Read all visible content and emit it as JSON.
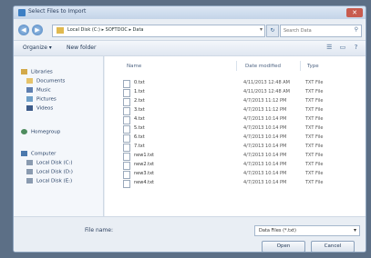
{
  "window": {
    "title": "Select Files to Import"
  },
  "address": {
    "path": "Local Disk (C:) ▸ SOFTDOC ▸ Data",
    "search_placeholder": "Search Data"
  },
  "toolbar": {
    "organize": "Organize ▾",
    "new_folder": "New folder"
  },
  "sidebar": {
    "items": [
      {
        "label": "Libraries",
        "icon": "library-icon"
      },
      {
        "label": "Documents",
        "icon": "documents-icon"
      },
      {
        "label": "Music",
        "icon": "music-icon"
      },
      {
        "label": "Pictures",
        "icon": "pictures-icon"
      },
      {
        "label": "Videos",
        "icon": "videos-icon"
      },
      {
        "label": "Homegroup",
        "icon": "homegroup-icon"
      },
      {
        "label": "Computer",
        "icon": "computer-icon"
      },
      {
        "label": "Local Disk (C:)",
        "icon": "drive-icon"
      },
      {
        "label": "Local Disk (D:)",
        "icon": "drive-icon"
      },
      {
        "label": "Local Disk (E:)",
        "icon": "drive-icon"
      }
    ]
  },
  "columns": {
    "name": "Name",
    "date": "Date modified",
    "type": "Type"
  },
  "files": [
    {
      "name": "0.txt",
      "date": "4/11/2013 12:48 AM",
      "type": "TXT File"
    },
    {
      "name": "1.txt",
      "date": "4/11/2013 12:48 AM",
      "type": "TXT File"
    },
    {
      "name": "2.txt",
      "date": "4/7/2013 11:12 PM",
      "type": "TXT File"
    },
    {
      "name": "3.txt",
      "date": "4/7/2013 11:12 PM",
      "type": "TXT File"
    },
    {
      "name": "4.txt",
      "date": "4/7/2013 10:14 PM",
      "type": "TXT File"
    },
    {
      "name": "5.txt",
      "date": "4/7/2013 10:14 PM",
      "type": "TXT File"
    },
    {
      "name": "6.txt",
      "date": "4/7/2013 10:14 PM",
      "type": "TXT File"
    },
    {
      "name": "7.txt",
      "date": "4/7/2013 10:14 PM",
      "type": "TXT File"
    },
    {
      "name": "new1.txt",
      "date": "4/7/2013 10:14 PM",
      "type": "TXT File"
    },
    {
      "name": "new2.txt",
      "date": "4/7/2013 10:14 PM",
      "type": "TXT File"
    },
    {
      "name": "new3.txt",
      "date": "4/7/2013 10:14 PM",
      "type": "TXT File"
    },
    {
      "name": "new4.txt",
      "date": "4/7/2013 10:14 PM",
      "type": "TXT File"
    }
  ],
  "footer": {
    "filename_label": "File name:",
    "filter": "Data Files (*.txt)",
    "open": "Open",
    "cancel": "Cancel"
  }
}
